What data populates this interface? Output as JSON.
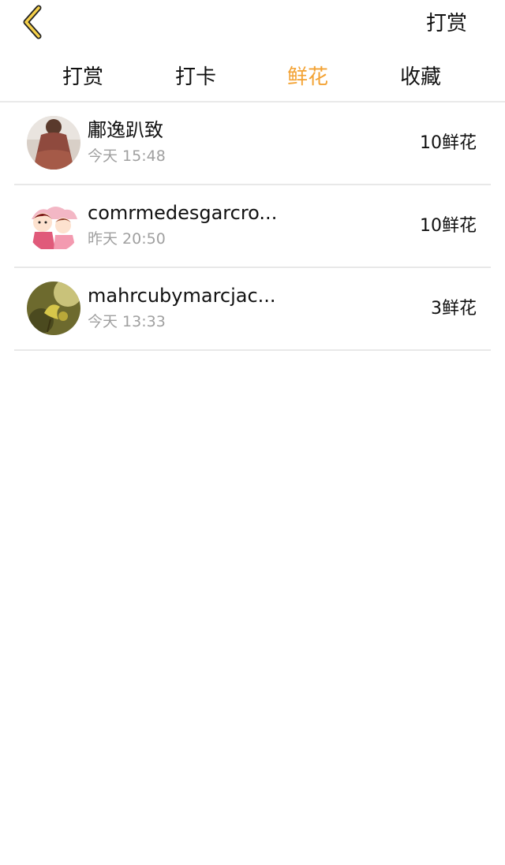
{
  "header": {
    "action_label": "打赏"
  },
  "tabs": [
    {
      "label": "打赏"
    },
    {
      "label": "打卡"
    },
    {
      "label": "鲜花"
    },
    {
      "label": "收藏"
    }
  ],
  "active_tab": 2,
  "colors": {
    "accent": "#f3a233",
    "back_chevron": "#f5d04a",
    "secondary_text": "#a0a0a0",
    "divider": "#e8e8e8"
  },
  "records": [
    {
      "name": "鄘逸趴致",
      "time": "今天 15:48",
      "amount": "10鲜花"
    },
    {
      "name": "comrmedesgarcro...",
      "time": "昨天 20:50",
      "amount": "10鲜花"
    },
    {
      "name": "mahrcubymarcjac...",
      "time": "今天 13:33",
      "amount": "3鲜花"
    }
  ]
}
